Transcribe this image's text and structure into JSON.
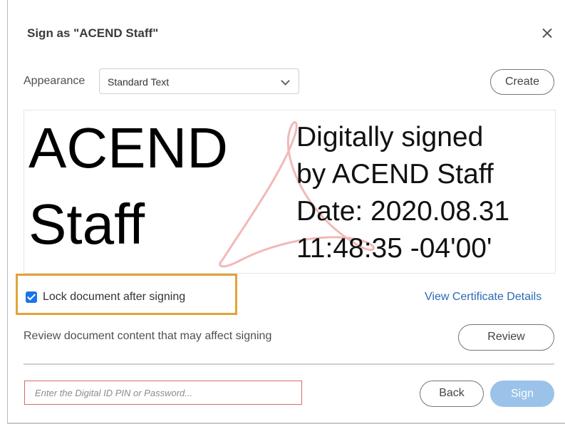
{
  "dialog": {
    "title": "Sign as \"ACEND Staff\"",
    "close_icon": "close-icon"
  },
  "appearance": {
    "label": "Appearance",
    "selected": "Standard Text",
    "create_label": "Create"
  },
  "preview": {
    "name_lines": [
      "ACEND",
      "Staff"
    ],
    "signature_lines": [
      "Digitally signed",
      "by ACEND Staff",
      "Date: 2020.08.31",
      "11:48:35 -04'00'"
    ],
    "watermark_icon": "acrobat-logo-icon"
  },
  "options": {
    "lock_label": "Lock document after signing",
    "lock_checked": true,
    "view_certificate": "View Certificate Details",
    "review_text": "Review document content that may affect signing",
    "review_label": "Review"
  },
  "footer": {
    "pin_placeholder": "Enter the Digital ID PIN or Password...",
    "back_label": "Back",
    "sign_label": "Sign"
  },
  "colors": {
    "highlight": "#e2a33a",
    "link": "#2b6bb5",
    "sign_button": "#9bc3ea",
    "checkbox": "#1a73e8",
    "pin_border": "#d96a6a"
  }
}
